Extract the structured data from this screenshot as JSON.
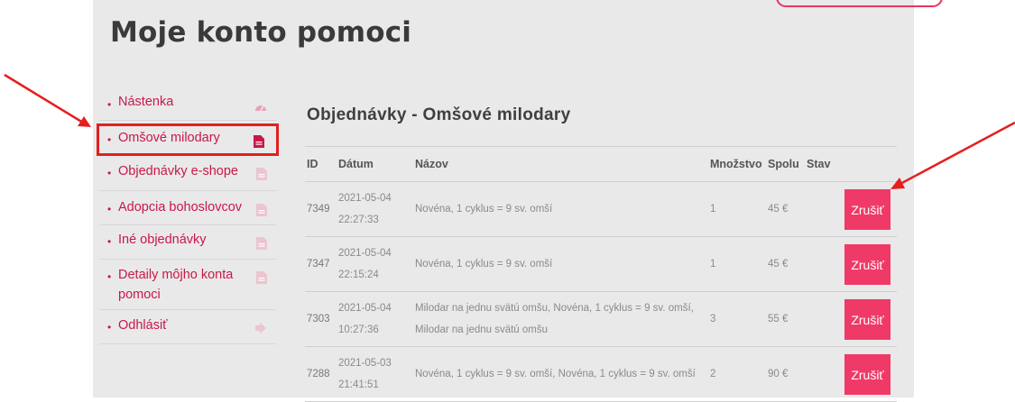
{
  "page_title": "Moje konto pomoci",
  "sidebar": {
    "items": [
      {
        "label": "Nástenka",
        "icon": "dashboard-icon"
      },
      {
        "label": "Omšové milodary",
        "icon": "document-icon"
      },
      {
        "label": "Objednávky e-shope",
        "icon": "document-icon"
      },
      {
        "label": "Adopcia bohoslovcov",
        "icon": "document-icon"
      },
      {
        "label": "Iné objednávky",
        "icon": "document-icon"
      },
      {
        "label": "Detaily môjho konta pomoci",
        "icon": "document-icon"
      },
      {
        "label": "Odhlásiť",
        "icon": "logout-icon"
      }
    ],
    "active_index": 1
  },
  "section_title": "Objednávky - Omšové milodary",
  "table": {
    "headers": {
      "id": "ID",
      "datum": "Dátum",
      "nazov": "Názov",
      "mnozstvo": "Množstvo",
      "spolu": "Spolu",
      "stav": "Stav"
    },
    "rows": [
      {
        "id": "7349",
        "date": "2021-05-04",
        "time": "22:27:33",
        "nazov": "Novéna, 1 cyklus = 9 sv. omší",
        "mnozstvo": "1",
        "spolu": "45 €",
        "button": "Zrušiť"
      },
      {
        "id": "7347",
        "date": "2021-05-04",
        "time": "22:15:24",
        "nazov": "Novéna, 1 cyklus = 9 sv. omší",
        "mnozstvo": "1",
        "spolu": "45 €",
        "button": "Zrušiť"
      },
      {
        "id": "7303",
        "date": "2021-05-04",
        "time": "10:27:36",
        "nazov": "Milodar na jednu svätú omšu, Novéna, 1 cyklus = 9 sv. omší, Milodar na jednu svätú omšu",
        "mnozstvo": "3",
        "spolu": "55 €",
        "button": "Zrušiť"
      },
      {
        "id": "7288",
        "date": "2021-05-03",
        "time": "21:41:51",
        "nazov": "Novéna, 1 cyklus = 9 sv. omší, Novéna, 1 cyklus = 9 sv. omší",
        "mnozstvo": "2",
        "spolu": "90 €",
        "button": "Zrušiť"
      }
    ]
  },
  "colors": {
    "accent": "#c8184a",
    "button": "#ef3a68",
    "annotation": "#e51e1e"
  }
}
